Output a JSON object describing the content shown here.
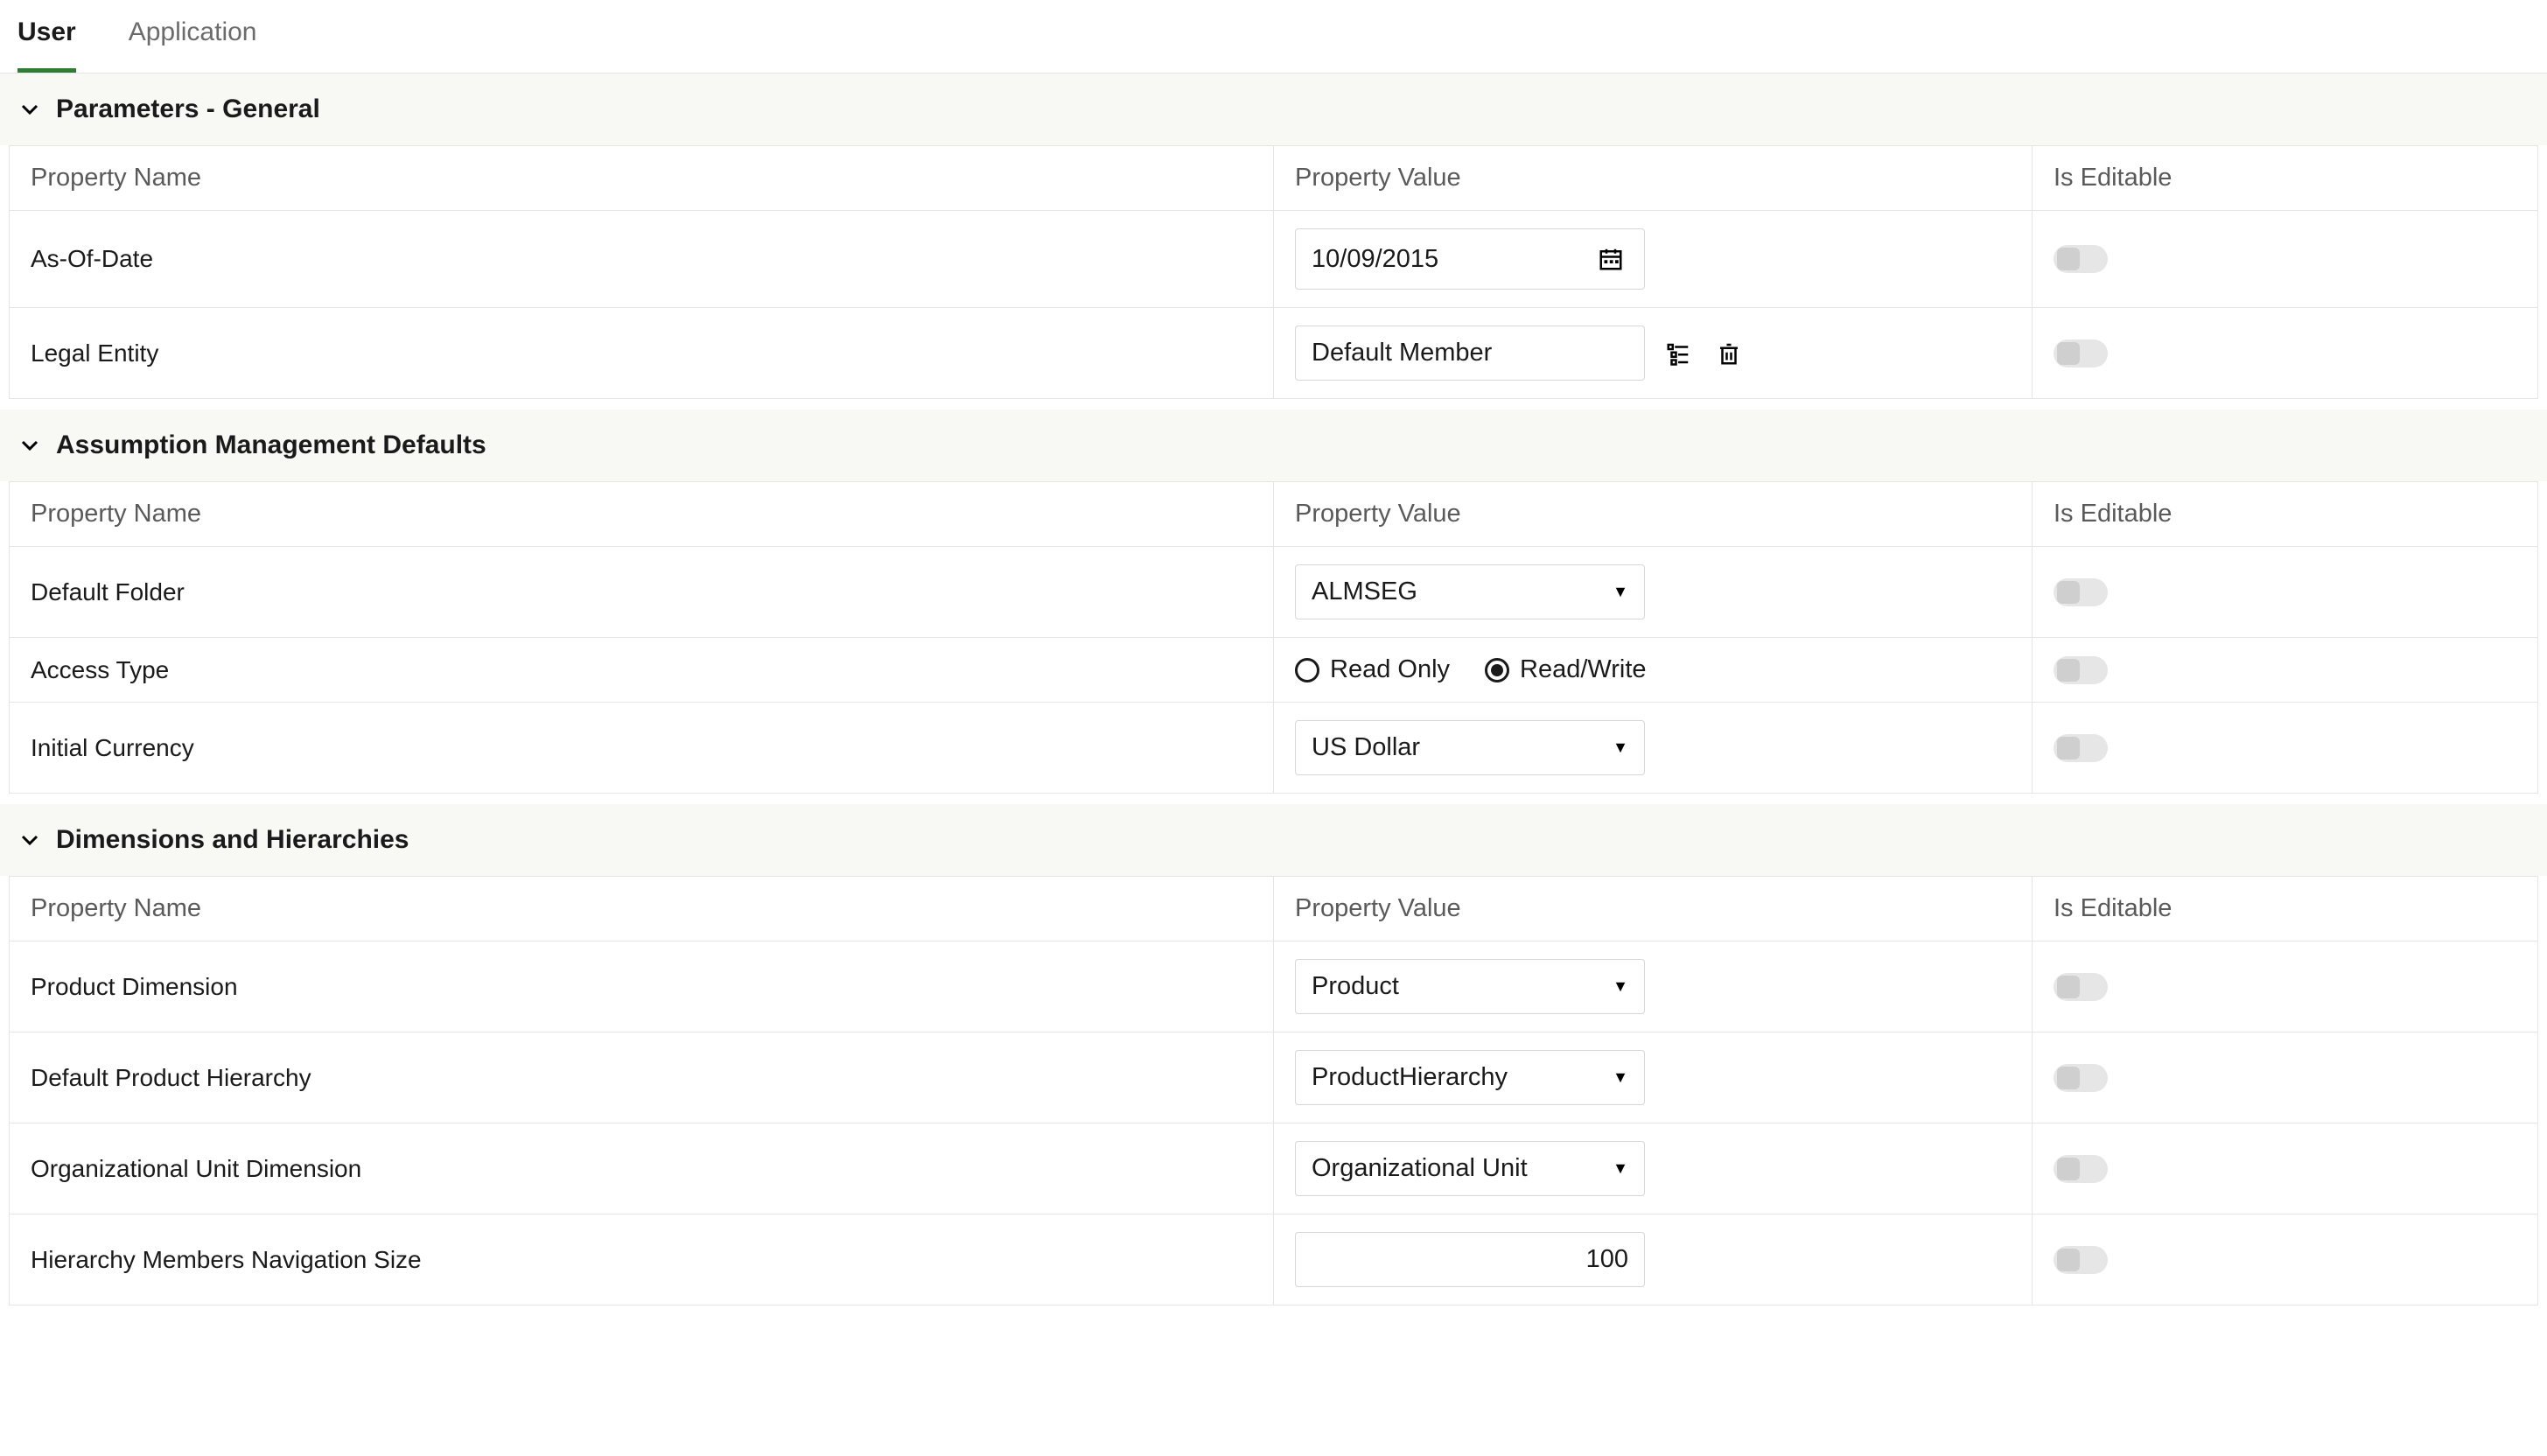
{
  "tabs": {
    "user": "User",
    "application": "Application",
    "active": "user"
  },
  "columns": {
    "name": "Property Name",
    "value": "Property Value",
    "editable": "Is Editable"
  },
  "sections": {
    "general": {
      "title": "Parameters - General",
      "rows": {
        "asOfDate": {
          "name": "As-Of-Date",
          "value": "10/09/2015"
        },
        "legalEntity": {
          "name": "Legal Entity",
          "value": "Default Member"
        }
      }
    },
    "assumptions": {
      "title": "Assumption Management Defaults",
      "rows": {
        "defaultFolder": {
          "name": "Default Folder",
          "value": "ALMSEG"
        },
        "accessType": {
          "name": "Access Type",
          "readonly": "Read Only",
          "readwrite": "Read/Write",
          "selected": "readwrite"
        },
        "initialCurrency": {
          "name": "Initial Currency",
          "value": "US Dollar"
        }
      }
    },
    "dimensions": {
      "title": "Dimensions and Hierarchies",
      "rows": {
        "productDim": {
          "name": "Product Dimension",
          "value": "Product"
        },
        "prodHierarchy": {
          "name": "Default Product Hierarchy",
          "value": "ProductHierarchy"
        },
        "orgUnitDim": {
          "name": "Organizational Unit Dimension",
          "value": "Organizational Unit"
        },
        "navSize": {
          "name": "Hierarchy Members Navigation Size",
          "value": "100"
        }
      }
    }
  }
}
